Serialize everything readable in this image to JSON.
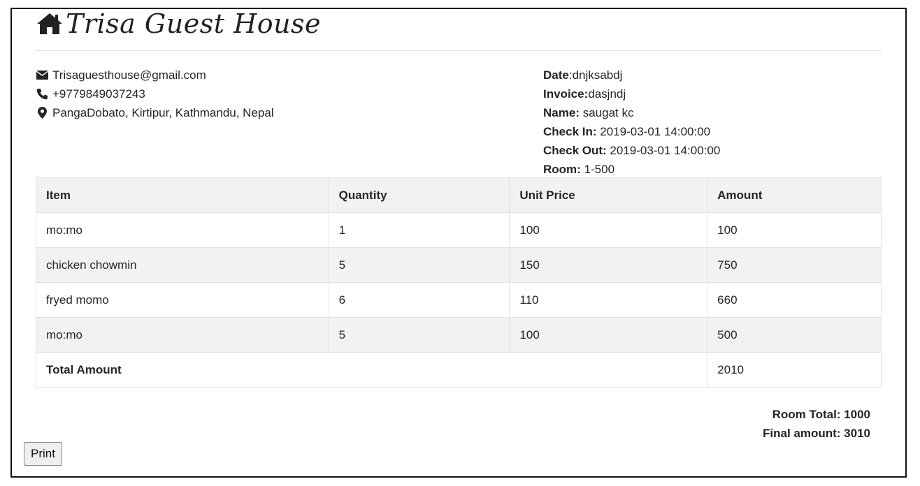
{
  "header": {
    "title": "Trisa Guest House",
    "icon": "home-icon"
  },
  "contact": {
    "email": "Trisaguesthouse@gmail.com",
    "phone": "+9779849037243",
    "address": "PangaDobato, Kirtipur, Kathmandu, Nepal"
  },
  "details": {
    "date_label": "Date",
    "date_value": "dnjksabdj",
    "invoice_label": "Invoice",
    "invoice_value": "dasjndj",
    "name_label": "Name:",
    "name_value": "saugat kc",
    "checkin_label": "Check In:",
    "checkin_value": "2019-03-01 14:00:00",
    "checkout_label": "Check Out:",
    "checkout_value": "2019-03-01 14:00:00",
    "room_label": "Room:",
    "room_value": "1-500"
  },
  "table": {
    "headers": [
      "Item",
      "Quantity",
      "Unit Price",
      "Amount"
    ],
    "rows": [
      [
        "mo:mo",
        "1",
        "100",
        "100"
      ],
      [
        "chicken chowmin",
        "5",
        "150",
        "750"
      ],
      [
        "fryed momo",
        "6",
        "110",
        "660"
      ],
      [
        "mo:mo",
        "5",
        "100",
        "500"
      ]
    ],
    "total_label": "Total Amount",
    "total_value": "2010"
  },
  "summary": {
    "room_total": "Room Total: 1000",
    "final_amount": "Final amount: 3010"
  },
  "actions": {
    "print_label": "Print"
  }
}
